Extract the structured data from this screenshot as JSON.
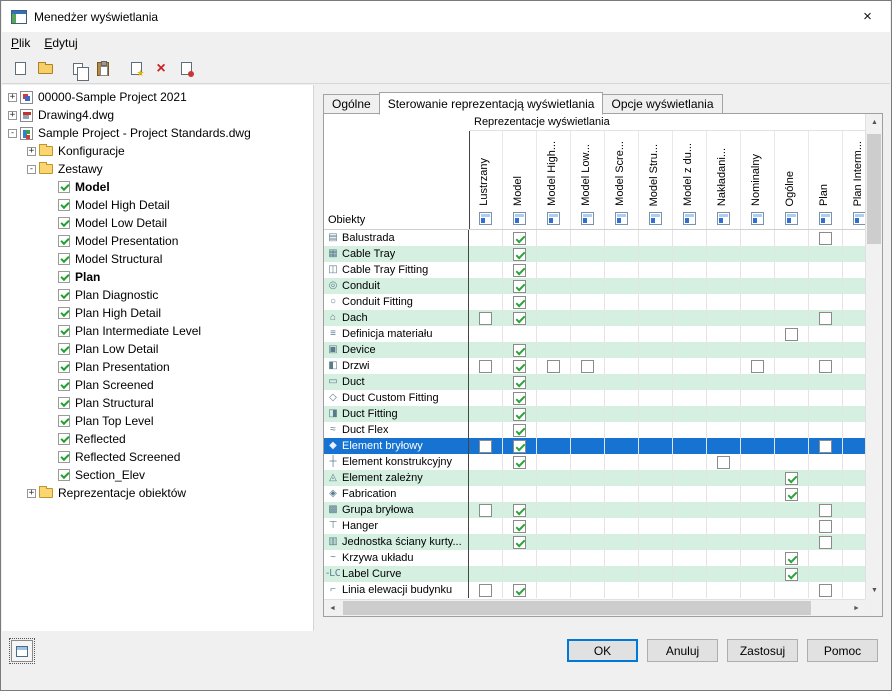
{
  "colors": {
    "accent": "#0078d7",
    "selection": "#1673d2",
    "row_band": "#d5efe1",
    "check_green": "#2fa43c",
    "titlebar_bg": "#ffffff",
    "dialog_bg": "#f0f0f0"
  },
  "window": {
    "title": "Menedżer wyświetlania",
    "close_glyph": "×"
  },
  "menu": {
    "items": [
      {
        "key": "P",
        "rest": "lik"
      },
      {
        "key": "E",
        "rest": "dytuj"
      }
    ]
  },
  "toolbar": {
    "buttons": [
      {
        "name": "new",
        "kind": "page"
      },
      {
        "name": "open",
        "kind": "folder",
        "sep": true
      },
      {
        "name": "copy",
        "kind": "pages"
      },
      {
        "name": "paste",
        "kind": "clipboard",
        "sep": true
      },
      {
        "name": "new-display-set",
        "kind": "page-star"
      },
      {
        "name": "delete",
        "kind": "delete-x",
        "glyph": "×"
      },
      {
        "name": "purge",
        "kind": "page-purge"
      }
    ]
  },
  "tree": {
    "items": [
      {
        "label": "00000-Sample Project 2021",
        "level": 0,
        "expand": "+",
        "icon": "project-drawing"
      },
      {
        "label": "Drawing4.dwg",
        "level": 0,
        "expand": "+",
        "icon": "drawing"
      },
      {
        "label": "Sample Project - Project Standards.dwg",
        "level": 0,
        "expand": "-",
        "icon": "standards-drawing"
      },
      {
        "label": "Konfiguracje",
        "level": 1,
        "expand": "+",
        "icon": "folder"
      },
      {
        "label": "Zestawy",
        "level": 1,
        "expand": "-",
        "icon": "folder"
      },
      {
        "label": "Model",
        "level": 2,
        "icon": "display-set",
        "bold": true
      },
      {
        "label": "Model High Detail",
        "level": 2,
        "icon": "display-set"
      },
      {
        "label": "Model Low Detail",
        "level": 2,
        "icon": "display-set"
      },
      {
        "label": "Model Presentation",
        "level": 2,
        "icon": "display-set"
      },
      {
        "label": "Model Structural",
        "level": 2,
        "icon": "display-set"
      },
      {
        "label": "Plan",
        "level": 2,
        "icon": "display-set",
        "bold": true
      },
      {
        "label": "Plan Diagnostic",
        "level": 2,
        "icon": "display-set"
      },
      {
        "label": "Plan High Detail",
        "level": 2,
        "icon": "display-set"
      },
      {
        "label": "Plan Intermediate Level",
        "level": 2,
        "icon": "display-set"
      },
      {
        "label": "Plan Low Detail",
        "level": 2,
        "icon": "display-set"
      },
      {
        "label": "Plan Presentation",
        "level": 2,
        "icon": "display-set"
      },
      {
        "label": "Plan Screened",
        "level": 2,
        "icon": "display-set"
      },
      {
        "label": "Plan Structural",
        "level": 2,
        "icon": "display-set"
      },
      {
        "label": "Plan Top Level",
        "level": 2,
        "icon": "display-set"
      },
      {
        "label": "Reflected",
        "level": 2,
        "icon": "display-set"
      },
      {
        "label": "Reflected Screened",
        "level": 2,
        "icon": "display-set"
      },
      {
        "label": "Section_Elev",
        "level": 2,
        "icon": "display-set"
      },
      {
        "label": "Reprezentacje obiektów",
        "level": 1,
        "expand": "+",
        "icon": "folder"
      }
    ]
  },
  "tabs": [
    {
      "label": "Ogólne",
      "active": false
    },
    {
      "label": "Sterowanie reprezentacją wyświetlania",
      "active": true
    },
    {
      "label": "Opcje wyświetlania",
      "active": false
    }
  ],
  "table": {
    "header_title": "Reprezentacje wyświetlania",
    "row_header": "Obiekty",
    "columns": [
      "Lustrzany",
      "Model",
      "Model High...",
      "Model Low...",
      "Model Scre...",
      "Model Stru...",
      "Model z du...",
      "Nakładani...",
      "Nominalny",
      "Ogólne",
      "Plan",
      "Plan Interm..."
    ],
    "rows": [
      {
        "label": "Balustrada",
        "icon": "railing-icon",
        "glyph": "▤",
        "checks": {
          "1": "checked",
          "10": "unchecked"
        }
      },
      {
        "label": "Cable Tray",
        "icon": "cable-tray-icon",
        "glyph": "▦",
        "checks": {
          "1": "checked"
        }
      },
      {
        "label": "Cable Tray Fitting",
        "icon": "cable-tray-fitting-icon",
        "glyph": "◫",
        "checks": {
          "1": "checked"
        }
      },
      {
        "label": "Conduit",
        "icon": "conduit-icon",
        "glyph": "◎",
        "checks": {
          "1": "checked"
        }
      },
      {
        "label": "Conduit Fitting",
        "icon": "conduit-fitting-icon",
        "glyph": "○",
        "checks": {
          "1": "checked"
        }
      },
      {
        "label": "Dach",
        "icon": "roof-icon",
        "glyph": "⌂",
        "checks": {
          "0": "unchecked",
          "1": "checked",
          "10": "unchecked"
        }
      },
      {
        "label": "Definicja materiału",
        "icon": "material-definition-icon",
        "glyph": "≡",
        "checks": {
          "9": "unchecked"
        }
      },
      {
        "label": "Device",
        "icon": "device-icon",
        "glyph": "▣",
        "checks": {
          "1": "checked"
        }
      },
      {
        "label": "Drzwi",
        "icon": "door-icon",
        "glyph": "◧",
        "checks": {
          "0": "unchecked",
          "1": "checked",
          "2": "unchecked",
          "3": "unchecked",
          "8": "unchecked",
          "10": "unchecked"
        }
      },
      {
        "label": "Duct",
        "icon": "duct-icon",
        "glyph": "▭",
        "checks": {
          "1": "checked"
        }
      },
      {
        "label": "Duct Custom Fitting",
        "icon": "duct-custom-fitting-icon",
        "glyph": "◇",
        "checks": {
          "1": "checked"
        }
      },
      {
        "label": "Duct Fitting",
        "icon": "duct-fitting-icon",
        "glyph": "◨",
        "checks": {
          "1": "checked"
        }
      },
      {
        "label": "Duct Flex",
        "icon": "duct-flex-icon",
        "glyph": "≈",
        "checks": {
          "1": "checked"
        }
      },
      {
        "label": "Element bryłowy",
        "icon": "mass-element-icon",
        "glyph": "◆",
        "selected": true,
        "checks": {
          "0": "unchecked",
          "1": "checked",
          "10": "unchecked"
        }
      },
      {
        "label": "Element konstrukcyjny",
        "icon": "structural-member-icon",
        "glyph": "┼",
        "checks": {
          "1": "checked",
          "7": "unchecked"
        }
      },
      {
        "label": "Element zależny",
        "icon": "dependent-element-icon",
        "glyph": "◬",
        "checks": {
          "9": "checked"
        }
      },
      {
        "label": "Fabrication",
        "icon": "fabrication-icon",
        "glyph": "◈",
        "checks": {
          "9": "checked"
        }
      },
      {
        "label": "Grupa bryłowa",
        "icon": "mass-group-icon",
        "glyph": "▩",
        "checks": {
          "0": "unchecked",
          "1": "checked",
          "10": "unchecked"
        }
      },
      {
        "label": "Hanger",
        "icon": "hanger-icon",
        "glyph": "⊤",
        "checks": {
          "1": "checked",
          "10": "unchecked"
        }
      },
      {
        "label": "Jednostka ściany kurty...",
        "icon": "curtain-wall-unit-icon",
        "glyph": "▥",
        "checks": {
          "1": "checked",
          "10": "unchecked"
        }
      },
      {
        "label": "Krzywa układu",
        "icon": "layout-curve-icon",
        "glyph": "~",
        "checks": {
          "9": "checked"
        }
      },
      {
        "label": "Label Curve",
        "icon": "label-curve-icon",
        "glyph": "-LC-",
        "checks": {
          "9": "checked"
        }
      },
      {
        "label": "Linia elewacji budynku",
        "icon": "building-elevation-line-icon",
        "glyph": "⌐",
        "checks": {
          "0": "unchecked",
          "1": "checked",
          "10": "unchecked"
        }
      }
    ]
  },
  "scrollbar": {
    "up": "▲",
    "down": "▼",
    "left": "◄",
    "right": "►"
  },
  "footer": {
    "buttons": [
      {
        "label": "OK",
        "default": true
      },
      {
        "label": "Anuluj"
      },
      {
        "label": "Zastosuj"
      },
      {
        "label": "Pomoc"
      }
    ]
  }
}
